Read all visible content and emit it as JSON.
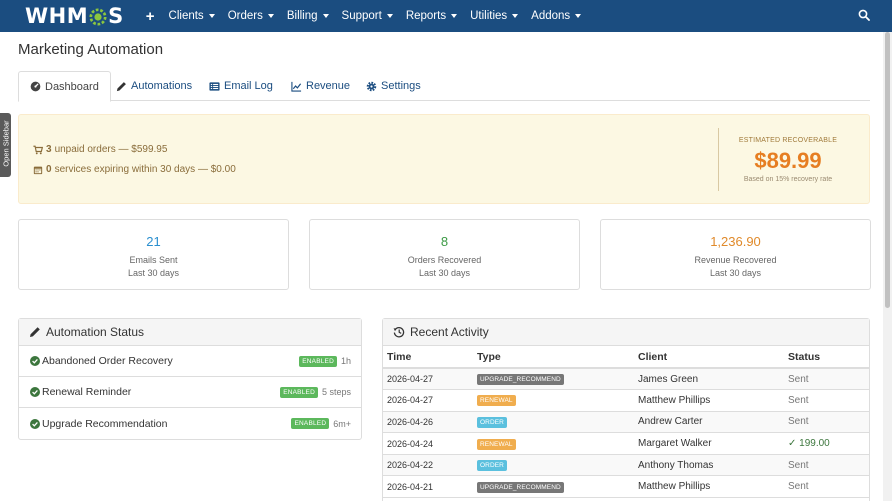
{
  "nav": {
    "logo": {
      "left": "WHM",
      "right": "S"
    },
    "plus": "+",
    "items": [
      "Clients",
      "Orders",
      "Billing",
      "Support",
      "Reports",
      "Utilities",
      "Addons"
    ]
  },
  "sidebar_tab": "Open Sidebar",
  "page": {
    "title": "Marketing Automation"
  },
  "tabs": [
    "Dashboard",
    "Automations",
    "Email Log",
    "Revenue",
    "Settings"
  ],
  "alert": {
    "unpaid_count": "3",
    "unpaid_text": "unpaid orders — $599.95",
    "expiring_count": "0",
    "expiring_text": "services expiring within 30 days — $0.00",
    "estimate_label": "ESTIMATED RECOVERABLE",
    "estimate_value": "$89.99",
    "estimate_note": "Based on 15% recovery rate"
  },
  "stats": [
    {
      "value": "21",
      "label": "Emails Sent",
      "sub": "Last 30 days",
      "color": "#2a8fcf"
    },
    {
      "value": "8",
      "label": "Orders Recovered",
      "sub": "Last 30 days",
      "color": "#3c9a45"
    },
    {
      "value": "1,236.90",
      "label": "Revenue Recovered",
      "sub": "Last 30 days",
      "color": "#e08a2b"
    }
  ],
  "automation_status": {
    "title": "Automation Status",
    "rows": [
      {
        "name": "Abandoned Order Recovery",
        "badge": "ENABLED",
        "timing": "1h"
      },
      {
        "name": "Renewal Reminder",
        "badge": "ENABLED",
        "timing": "5 steps"
      },
      {
        "name": "Upgrade Recommendation",
        "badge": "ENABLED",
        "timing": "6m+"
      }
    ]
  },
  "recent_activity": {
    "title": "Recent Activity",
    "columns": [
      "Time",
      "Type",
      "Client",
      "Status"
    ],
    "rows": [
      {
        "time": "2026-04-27",
        "type": "UPGRADE_RECOMMEND",
        "client": "James Green",
        "status": "Sent"
      },
      {
        "time": "2026-04-27",
        "type": "RENEWAL",
        "client": "Matthew Phillips",
        "status": "Sent"
      },
      {
        "time": "2026-04-26",
        "type": "ORDER",
        "client": "Andrew Carter",
        "status": "Sent"
      },
      {
        "time": "2026-04-24",
        "type": "RENEWAL",
        "client": "Margaret Walker",
        "status": "✓ 199.00"
      },
      {
        "time": "2026-04-22",
        "type": "ORDER",
        "client": "Anthony Thomas",
        "status": "Sent"
      },
      {
        "time": "2026-04-21",
        "type": "UPGRADE_RECOMMEND",
        "client": "Matthew Phillips",
        "status": "Sent"
      }
    ]
  },
  "colors": {
    "nav_bg": "#1b4d80",
    "enabled_green": "#5cb85c",
    "estimate_orange": "#e67e22"
  }
}
